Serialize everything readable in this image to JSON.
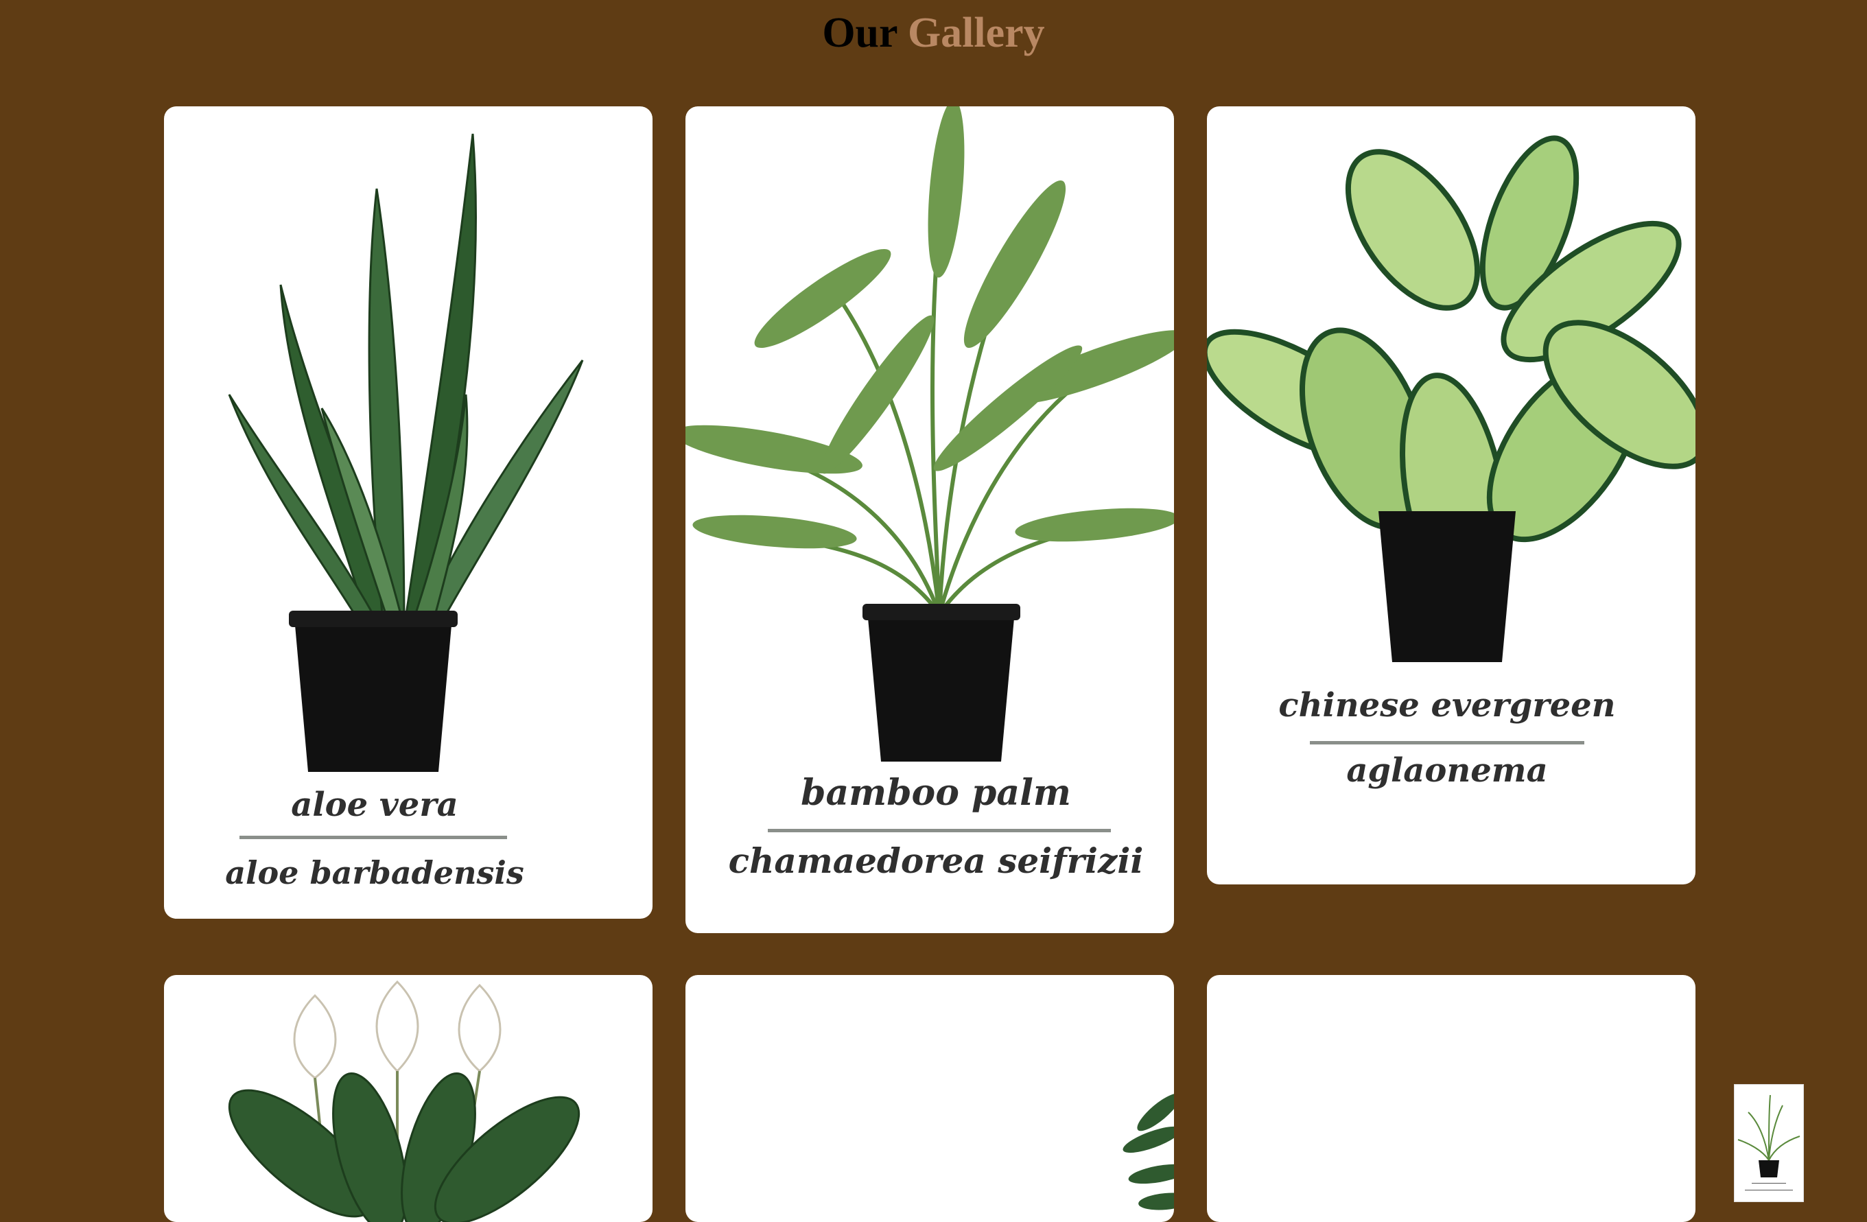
{
  "header": {
    "title_word1": "Our",
    "title_word2": "Gallery",
    "accent_color": "#b98863",
    "background_color": "#5f3c14"
  },
  "gallery": [
    {
      "common_name": "aloe vera",
      "latin_name": "aloe barbadensis",
      "illustration": "aloe-vera-plant"
    },
    {
      "common_name": "bamboo palm",
      "latin_name": "chamaedorea seifrizii",
      "illustration": "bamboo-palm-plant"
    },
    {
      "common_name": "chinese evergreen",
      "latin_name": "aglaonema",
      "illustration": "chinese-evergreen-plant"
    },
    {
      "illustration": "peace-lily-plant"
    },
    {
      "illustration": "fern-plant"
    },
    {
      "illustration": "blank"
    }
  ],
  "floating_thumbnail": {
    "illustration": "bamboo-palm-thumbnail"
  }
}
